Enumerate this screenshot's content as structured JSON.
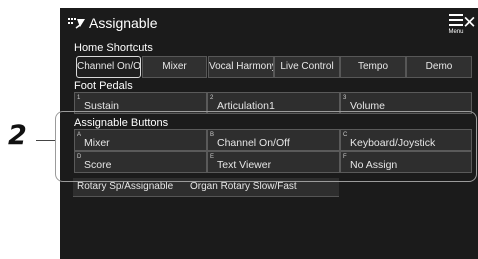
{
  "callout": {
    "number": "2"
  },
  "header": {
    "title": "Assignable",
    "menu_label": "Menu",
    "close_symbol": "✕"
  },
  "home_shortcuts": {
    "label": "Home Shortcuts",
    "buttons": [
      "Channel On/Off",
      "Mixer",
      "Vocal Harmony",
      "Live Control",
      "Tempo",
      "Demo"
    ],
    "selected": "Channel On/Off"
  },
  "foot_pedals": {
    "label": "Foot Pedals",
    "items": [
      {
        "num": "1",
        "label": "Sustain"
      },
      {
        "num": "2",
        "label": "Articulation1"
      },
      {
        "num": "3",
        "label": "Volume"
      }
    ]
  },
  "assignable_buttons": {
    "label": "Assignable Buttons",
    "items": [
      {
        "key": "A",
        "label": "Mixer"
      },
      {
        "key": "B",
        "label": "Channel On/Off"
      },
      {
        "key": "C",
        "label": "Keyboard/Joystick"
      },
      {
        "key": "D",
        "label": "Score"
      },
      {
        "key": "E",
        "label": "Text Viewer"
      },
      {
        "key": "F",
        "label": "No Assign"
      }
    ]
  },
  "rotary": {
    "items": [
      "Rotary Sp/Assignable",
      "Organ Rotary Slow/Fast"
    ]
  },
  "icons": {
    "title_icon": "assignable-icon",
    "menu_icon": "hamburger-menu-icon",
    "close_icon": "close-icon"
  }
}
